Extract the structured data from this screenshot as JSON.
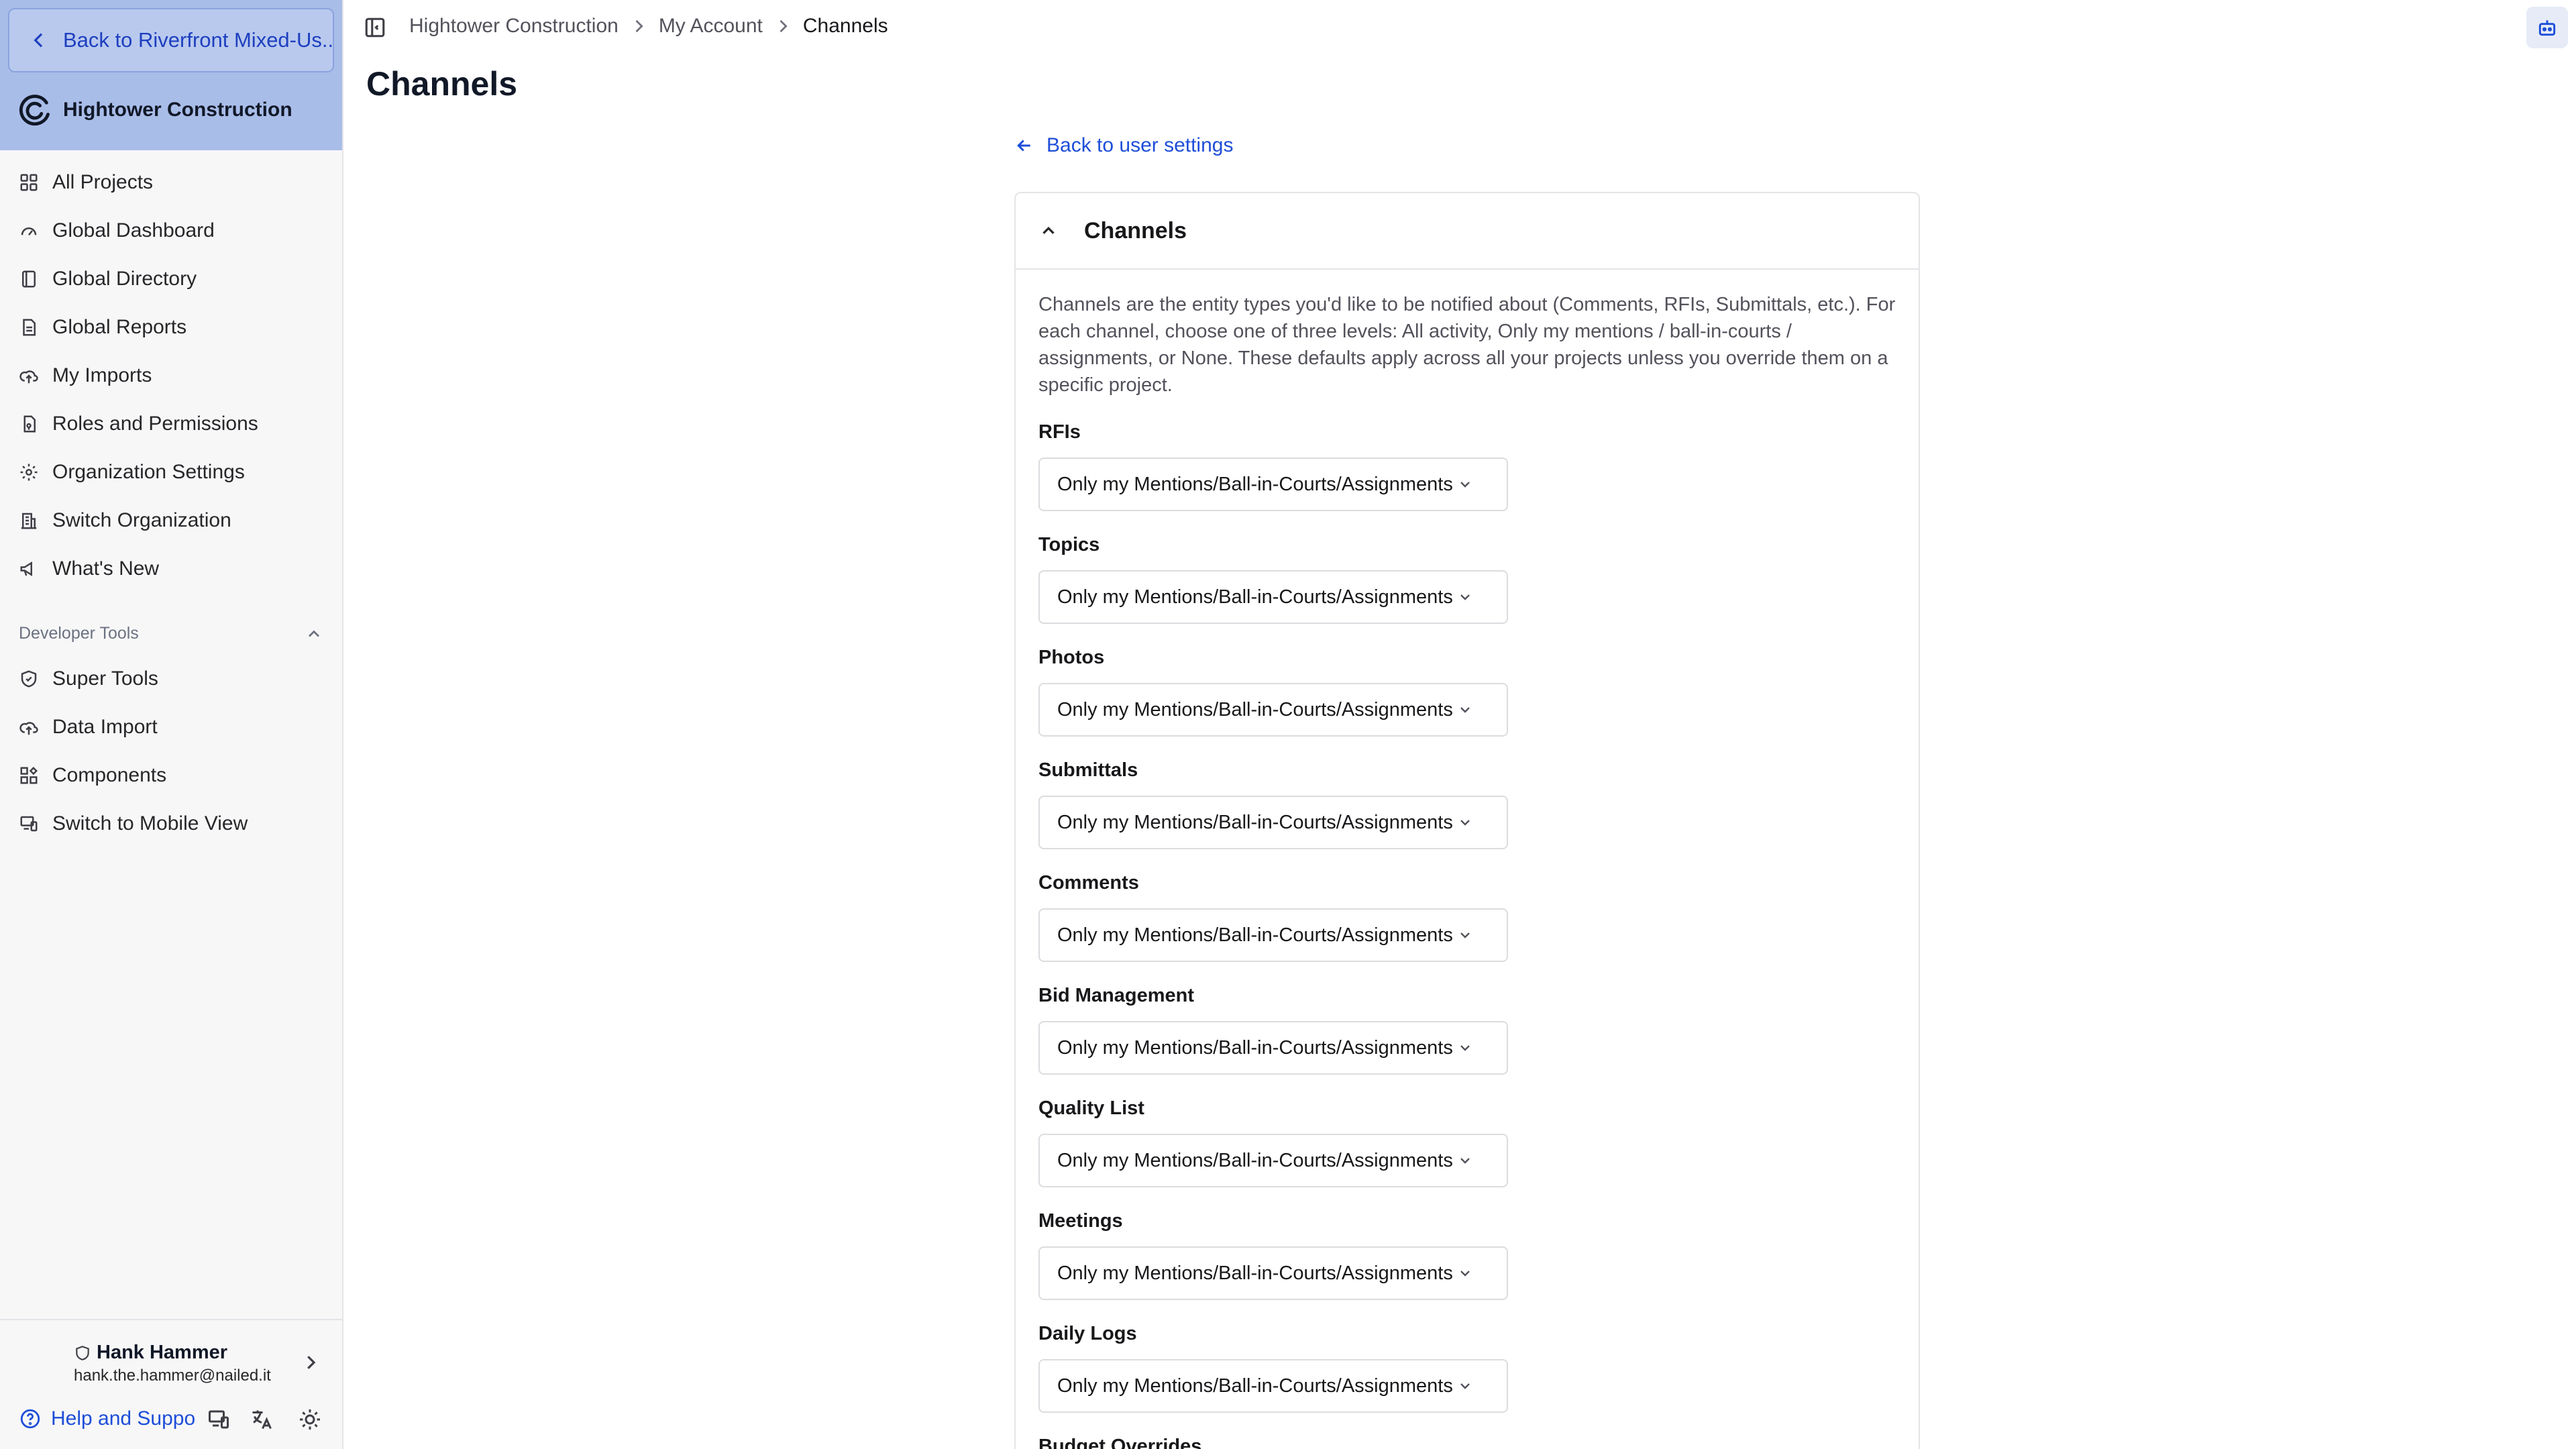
{
  "sidebar": {
    "back_label": "Back to Riverfront Mixed-Us...",
    "org_name": "Hightower Construction",
    "items": [
      {
        "label": "All Projects",
        "icon": "grid-icon"
      },
      {
        "label": "Global Dashboard",
        "icon": "gauge-icon"
      },
      {
        "label": "Global Directory",
        "icon": "address-book-icon"
      },
      {
        "label": "Global Reports",
        "icon": "report-icon"
      },
      {
        "label": "My Imports",
        "icon": "cloud-upload-icon"
      },
      {
        "label": "Roles and Permissions",
        "icon": "key-file-icon"
      },
      {
        "label": "Organization Settings",
        "icon": "gear-icon"
      },
      {
        "label": "Switch Organization",
        "icon": "building-icon"
      },
      {
        "label": "What's New",
        "icon": "megaphone-icon"
      }
    ],
    "dev_section_label": "Developer Tools",
    "dev_items": [
      {
        "label": "Super Tools",
        "icon": "shield-icon"
      },
      {
        "label": "Data Import",
        "icon": "cloud-upload-icon"
      },
      {
        "label": "Components",
        "icon": "components-icon"
      },
      {
        "label": "Switch to Mobile View",
        "icon": "devices-icon"
      }
    ],
    "user": {
      "name": "Hank Hammer",
      "email": "hank.the.hammer@nailed.it"
    },
    "help_label": "Help and Suppo"
  },
  "breadcrumb": [
    "Hightower Construction",
    "My Account",
    "Channels"
  ],
  "page_title": "Channels",
  "back_settings_label": "Back to user settings",
  "card": {
    "title": "Channels",
    "description": "Channels are the entity types you'd like to be notified about (Comments, RFIs, Submittals, etc.). For each channel, choose one of three levels: All activity, Only my mentions / ball-in-courts / assignments, or None. These defaults apply across all your projects unless you override them on a specific project.",
    "channels": [
      {
        "label": "RFIs",
        "value": "Only my Mentions/Ball-in-Courts/Assignments"
      },
      {
        "label": "Topics",
        "value": "Only my Mentions/Ball-in-Courts/Assignments"
      },
      {
        "label": "Photos",
        "value": "Only my Mentions/Ball-in-Courts/Assignments"
      },
      {
        "label": "Submittals",
        "value": "Only my Mentions/Ball-in-Courts/Assignments"
      },
      {
        "label": "Comments",
        "value": "Only my Mentions/Ball-in-Courts/Assignments"
      },
      {
        "label": "Bid Management",
        "value": "Only my Mentions/Ball-in-Courts/Assignments"
      },
      {
        "label": "Quality List",
        "value": "Only my Mentions/Ball-in-Courts/Assignments"
      },
      {
        "label": "Meetings",
        "value": "Only my Mentions/Ball-in-Courts/Assignments"
      },
      {
        "label": "Daily Logs",
        "value": "Only my Mentions/Ball-in-Courts/Assignments"
      },
      {
        "label": "Budget Overrides",
        "value": ""
      }
    ]
  },
  "colors": {
    "sidebar_header": "#a9bde9",
    "link": "#1d4ed8",
    "sidebar_bg": "#f7f7f8"
  }
}
